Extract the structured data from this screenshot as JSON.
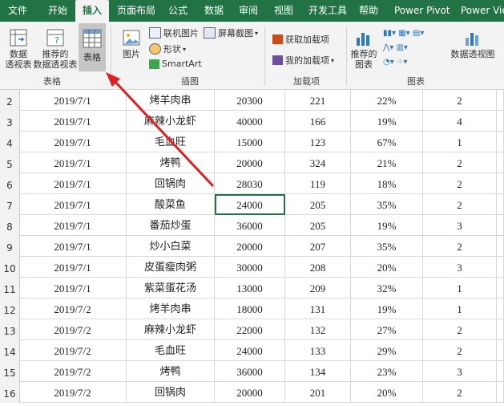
{
  "ribbon_tabs": [
    "文件",
    "开始",
    "插入",
    "页面布局",
    "公式",
    "数据",
    "审阅",
    "视图",
    "开发工具",
    "帮助",
    "Power Pivot",
    "Power View"
  ],
  "active_tab": "插入",
  "ribbon": {
    "pivot_label_1": "数据",
    "pivot_label_2": "透视表",
    "recommended_label_1": "推荐的",
    "recommended_label_2": "数据透视表",
    "table_label": "表格",
    "group_tables": "表格",
    "picture_label": "图片",
    "online_pictures": "联机图片",
    "shapes": "形状",
    "smartart": "SmartArt",
    "screenshot": "屏幕截图",
    "group_illustrations": "插图",
    "get_addins": "获取加载项",
    "my_addins": "我的加载项",
    "group_addins": "加载项",
    "recommended_charts_1": "推荐的",
    "recommended_charts_2": "图表",
    "pivot_chart": "数据透视图",
    "group_charts": "图表"
  },
  "rows": [
    {
      "num": "2",
      "date": "2019/7/1",
      "dish": "烤羊肉串",
      "amount": "20300",
      "c4": "221",
      "pct": "22%",
      "c6": "2"
    },
    {
      "num": "3",
      "date": "2019/7/1",
      "dish": "麻辣小龙虾",
      "amount": "40000",
      "c4": "166",
      "pct": "19%",
      "c6": "4"
    },
    {
      "num": "4",
      "date": "2019/7/1",
      "dish": "毛血旺",
      "amount": "15000",
      "c4": "123",
      "pct": "67%",
      "c6": "1"
    },
    {
      "num": "5",
      "date": "2019/7/1",
      "dish": "烤鸭",
      "amount": "20000",
      "c4": "324",
      "pct": "21%",
      "c6": "2"
    },
    {
      "num": "6",
      "date": "2019/7/1",
      "dish": "回锅肉",
      "amount": "28030",
      "c4": "119",
      "pct": "18%",
      "c6": "2"
    },
    {
      "num": "7",
      "date": "2019/7/1",
      "dish": "酸菜鱼",
      "amount": "24000",
      "c4": "205",
      "pct": "35%",
      "c6": "2"
    },
    {
      "num": "8",
      "date": "2019/7/1",
      "dish": "番茄炒蛋",
      "amount": "36000",
      "c4": "205",
      "pct": "19%",
      "c6": "3"
    },
    {
      "num": "9",
      "date": "2019/7/1",
      "dish": "炒小白菜",
      "amount": "20000",
      "c4": "207",
      "pct": "35%",
      "c6": "2"
    },
    {
      "num": "10",
      "date": "2019/7/1",
      "dish": "皮蛋瘦肉粥",
      "amount": "30000",
      "c4": "208",
      "pct": "20%",
      "c6": "3"
    },
    {
      "num": "11",
      "date": "2019/7/1",
      "dish": "紫菜蛋花汤",
      "amount": "13000",
      "c4": "209",
      "pct": "32%",
      "c6": "1"
    },
    {
      "num": "12",
      "date": "2019/7/2",
      "dish": "烤羊肉串",
      "amount": "18000",
      "c4": "131",
      "pct": "19%",
      "c6": "1"
    },
    {
      "num": "13",
      "date": "2019/7/2",
      "dish": "麻辣小龙虾",
      "amount": "22000",
      "c4": "132",
      "pct": "27%",
      "c6": "2"
    },
    {
      "num": "14",
      "date": "2019/7/2",
      "dish": "毛血旺",
      "amount": "24000",
      "c4": "133",
      "pct": "29%",
      "c6": "2"
    },
    {
      "num": "15",
      "date": "2019/7/2",
      "dish": "烤鸭",
      "amount": "36000",
      "c4": "134",
      "pct": "23%",
      "c6": "3"
    },
    {
      "num": "16",
      "date": "2019/7/2",
      "dish": "回锅肉",
      "amount": "20000",
      "c4": "201",
      "pct": "20%",
      "c6": "2"
    }
  ],
  "selected_row_index": 5,
  "colors": {
    "ribbon_green": "#217346",
    "arrow_red": "#e02020",
    "selection": "#217346"
  }
}
